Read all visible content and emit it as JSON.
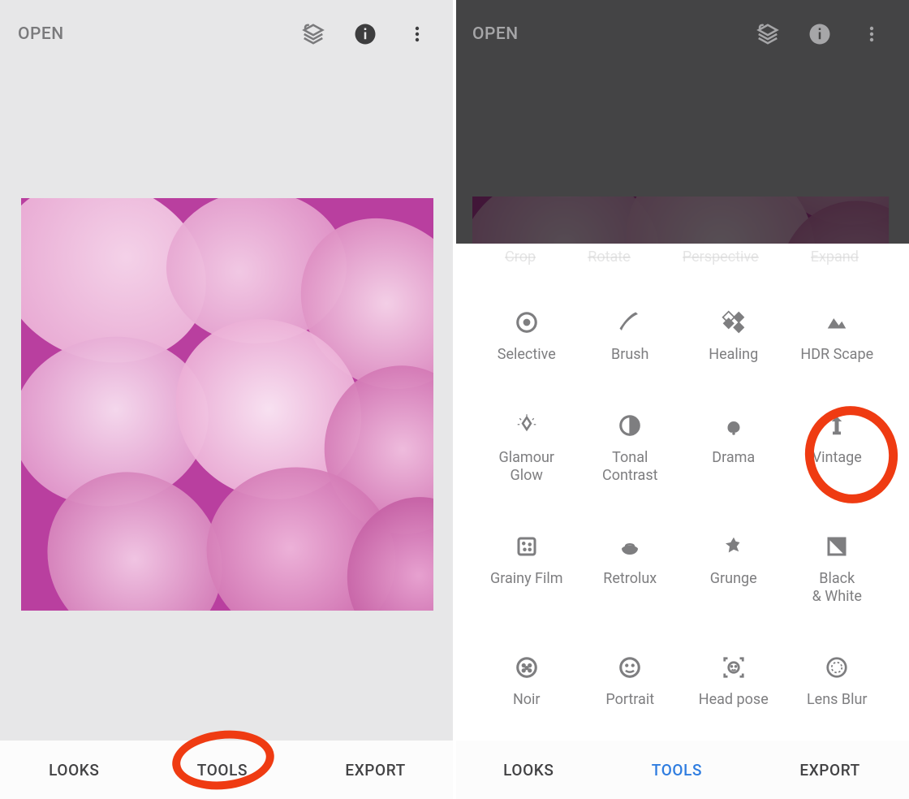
{
  "left": {
    "header": {
      "open": "OPEN"
    },
    "tabs": {
      "looks": "LOOKS",
      "tools": "TOOLS",
      "export": "EXPORT"
    }
  },
  "right": {
    "header": {
      "open": "OPEN"
    },
    "partial_row": [
      "Crop",
      "Rotate",
      "Perspective",
      "Expand"
    ],
    "tools": [
      {
        "id": "selective",
        "label": "Selective"
      },
      {
        "id": "brush",
        "label": "Brush"
      },
      {
        "id": "healing",
        "label": "Healing"
      },
      {
        "id": "hdr-scape",
        "label": "HDR Scape"
      },
      {
        "id": "glamour-glow",
        "label": "Glamour\nGlow"
      },
      {
        "id": "tonal-contrast",
        "label": "Tonal\nContrast"
      },
      {
        "id": "drama",
        "label": "Drama"
      },
      {
        "id": "vintage",
        "label": "Vintage"
      },
      {
        "id": "grainy-film",
        "label": "Grainy Film"
      },
      {
        "id": "retrolux",
        "label": "Retrolux"
      },
      {
        "id": "grunge",
        "label": "Grunge"
      },
      {
        "id": "black-white",
        "label": "Black\n& White"
      },
      {
        "id": "noir",
        "label": "Noir"
      },
      {
        "id": "portrait",
        "label": "Portrait"
      },
      {
        "id": "head-pose",
        "label": "Head pose"
      },
      {
        "id": "lens-blur",
        "label": "Lens Blur"
      }
    ],
    "tabs": {
      "looks": "LOOKS",
      "tools": "TOOLS",
      "export": "EXPORT"
    },
    "highlighted_tool": "vintage",
    "active_tab": "tools"
  },
  "colors": {
    "accent_blue": "#2f7de0",
    "annotation_red": "#ef3b12",
    "icon_grey": "#7e7e80"
  },
  "annotations": {
    "left_circled": "TOOLS",
    "right_circled": "Vintage"
  }
}
